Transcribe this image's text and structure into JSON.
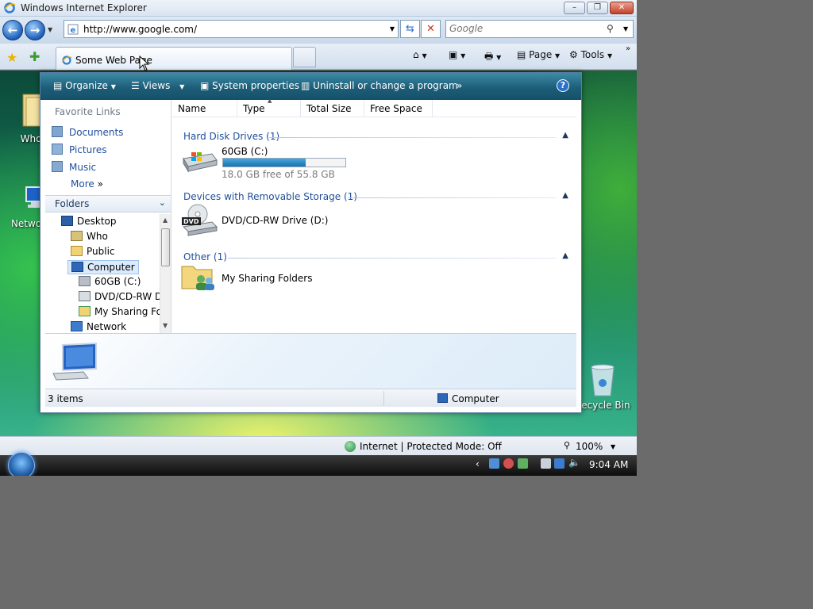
{
  "ie": {
    "title": "Windows Internet Explorer",
    "address": "http://www.google.com/",
    "search_placeholder": "Google",
    "tab_label": "Some Web Page",
    "commands": {
      "page": "Page",
      "tools": "Tools"
    },
    "status_zone": "Internet | Protected Mode: Off",
    "zoom": "100%"
  },
  "desktop": {
    "icons": [
      "Who",
      "Network",
      "Recycle Bin"
    ]
  },
  "explorer": {
    "toolbar": {
      "organize": "Organize",
      "views": "Views",
      "system_properties": "System properties",
      "uninstall": "Uninstall or change a program"
    },
    "favorites": {
      "heading": "Favorite Links",
      "links": [
        "Documents",
        "Pictures",
        "Music",
        "More"
      ]
    },
    "folders": {
      "title": "Folders",
      "tree": [
        "Desktop",
        "Who",
        "Public",
        "Computer",
        "60GB (C:)",
        "DVD/CD-RW D",
        "My Sharing Fo",
        "Network"
      ]
    },
    "columns": [
      "Name",
      "Type",
      "Total Size",
      "Free Space"
    ],
    "groups": [
      {
        "title": "Hard Disk Drives (1)"
      },
      {
        "title": "Devices with Removable Storage (1)"
      },
      {
        "title": "Other (1)"
      }
    ],
    "items": {
      "drive_c": {
        "label": "60GB (C:)",
        "free_text": "18.0 GB free of 55.8 GB",
        "used_fraction": 0.677
      },
      "dvd": {
        "label": "DVD/CD-RW Drive (D:)",
        "badge": "DVD"
      },
      "sharing": {
        "label": "My Sharing Folders"
      }
    },
    "status": {
      "count": "3 items",
      "location": "Computer"
    }
  },
  "taskbar": {
    "clock": "9:04 AM"
  },
  "colors": {
    "toolbar": "#1d5e78",
    "link": "#1e4e9b",
    "progress": "#1b6fb1"
  }
}
